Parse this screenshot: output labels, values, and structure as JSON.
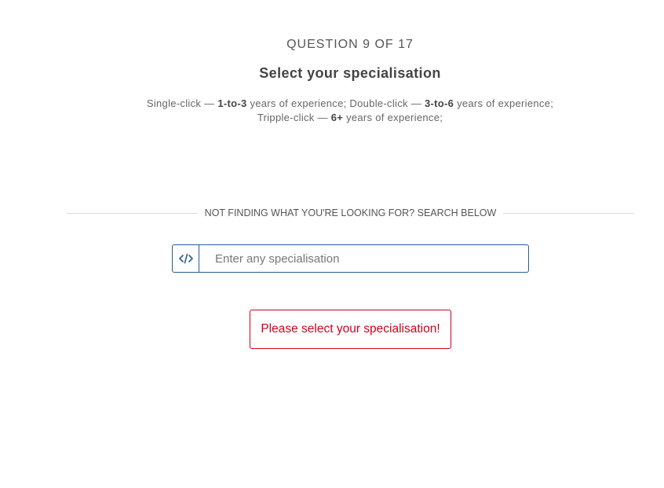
{
  "question": {
    "progress_label": "QUESTION 9 OF 17",
    "title": "Select your specialisation",
    "hint": {
      "single_prefix": "Single-click — ",
      "single_range": "1-to-3",
      "single_suffix": " years of experience; Double-click — ",
      "double_range": "3-to-6",
      "double_suffix": " years of experience;",
      "triple_prefix": "Tripple-click — ",
      "triple_range": "6+",
      "triple_suffix": " years of experience;"
    }
  },
  "search": {
    "divider_label": "NOT FINDING WHAT YOU'RE LOOKING FOR? SEARCH BELOW",
    "icon": "code-icon",
    "value": "",
    "placeholder": "Enter any specialisation"
  },
  "validation": {
    "error_message": "Please select your specialisation!"
  },
  "colors": {
    "accent": "#2a5d8f",
    "error": "#d0021b",
    "text": "#444444",
    "divider": "#dddddd"
  }
}
